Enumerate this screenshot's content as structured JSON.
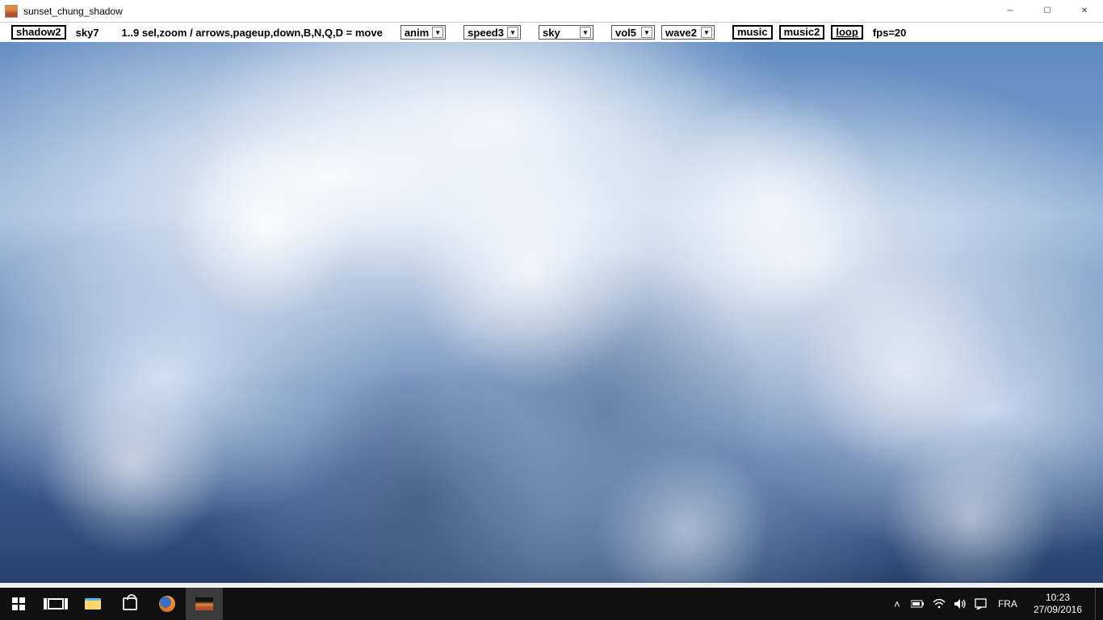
{
  "window": {
    "title": "sunset_chung_shadow"
  },
  "toolbar": {
    "shadow_btn": "shadow2",
    "sky_label": "sky7",
    "help_text": "1..9 sel,zoom / arrows,pageup,down,B,N,Q,D = move",
    "anim_select": "anim",
    "speed_select": "speed3",
    "sky_select": "sky",
    "vol_select": "vol5",
    "wave_select": "wave2",
    "music_btn": "music",
    "music2_btn": "music2",
    "loop_btn": "loop",
    "fps_label": "fps=20"
  },
  "taskbar": {
    "lang": "FRA",
    "time": "10:23",
    "date": "27/09/2016"
  }
}
